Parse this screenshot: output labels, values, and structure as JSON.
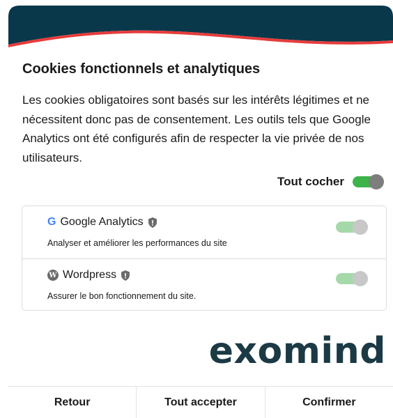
{
  "header": {
    "bg_color": "#08384a",
    "accent_color": "#e63c3c"
  },
  "title": "Cookies fonctionnels et analytiques",
  "description": "Les cookies obligatoires sont basés sur les intérêts légitimes et ne nécessitent donc pas de consentement. Les outils tels que Google Analytics ont été configurés afin de respecter la vie privée de nos utilisateurs.",
  "check_all": {
    "label": "Tout cocher",
    "checked": true
  },
  "items": [
    {
      "icon": "google-icon",
      "icon_glyph": "G",
      "name": "Google Analytics",
      "description": "Analyser et améliorer les performances du site",
      "enabled": true,
      "locked": true
    },
    {
      "icon": "wordpress-icon",
      "icon_glyph": "W",
      "name": "Wordpress",
      "description": "Assurer le bon fonctionnement du site.",
      "enabled": true,
      "locked": true
    }
  ],
  "logo": "exomind",
  "footer": {
    "back": "Retour",
    "accept_all": "Tout accepter",
    "confirm": "Confirmer"
  },
  "colors": {
    "toggle_on": "#3cb44a",
    "toggle_disabled": "#a6d9aa",
    "logo": "#1b3a45"
  }
}
